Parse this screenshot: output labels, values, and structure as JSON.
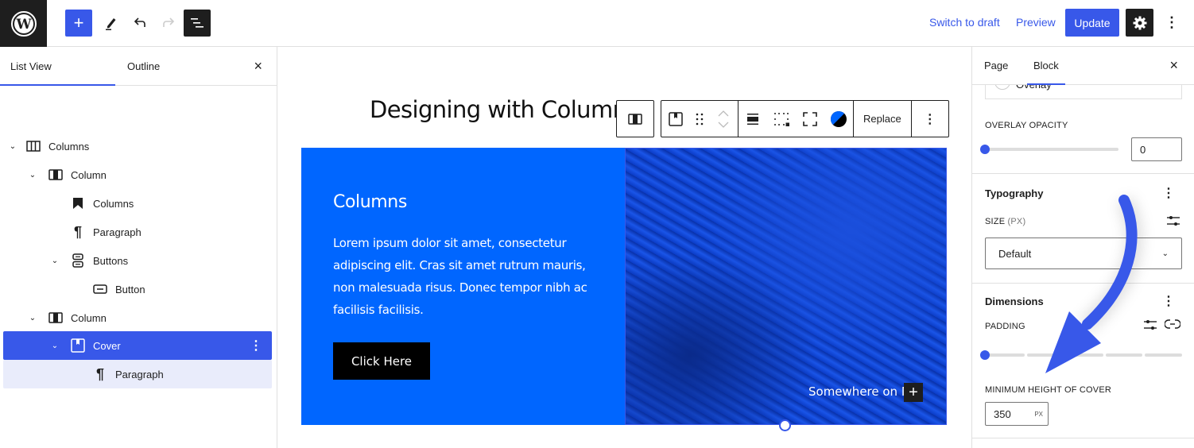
{
  "topbar": {
    "logo": "wordpress-logo",
    "add_block_label": "+",
    "switch_to_draft": "Switch to draft",
    "preview": "Preview",
    "update": "Update",
    "more": "⋮"
  },
  "left_panel": {
    "tabs": [
      {
        "label": "List View",
        "active": true
      },
      {
        "label": "Outline",
        "active": false
      }
    ],
    "close": "×",
    "tree": [
      {
        "label": "Columns",
        "icon": "columns-icon",
        "level": 0,
        "expanded": true
      },
      {
        "label": "Column",
        "icon": "column-icon",
        "level": 1,
        "expanded": true
      },
      {
        "label": "Columns",
        "icon": "bookmark-icon",
        "level": 2,
        "expanded": null
      },
      {
        "label": "Paragraph",
        "icon": "paragraph-icon",
        "level": 2,
        "expanded": null
      },
      {
        "label": "Buttons",
        "icon": "buttons-icon",
        "level": 2,
        "expanded": true
      },
      {
        "label": "Button",
        "icon": "button-icon",
        "level": 3,
        "expanded": null
      },
      {
        "label": "Column",
        "icon": "column-icon",
        "level": 1,
        "expanded": true
      },
      {
        "label": "Cover",
        "icon": "cover-icon",
        "level": 2,
        "expanded": true,
        "selected": true
      },
      {
        "label": "Paragraph",
        "icon": "paragraph-icon",
        "level": 3,
        "expanded": null,
        "child_selected": true
      }
    ]
  },
  "canvas": {
    "page_title": "Designing with Columns",
    "left_column": {
      "heading": "Columns",
      "paragraph": "Lorem ipsum dolor sit amet, consectetur adipiscing elit. Cras sit amet rutrum mauris, non malesuada risus. Donec tempor nibh ac facilisis facilisis.",
      "button": "Click Here",
      "background": "#0066ff"
    },
    "cover": {
      "text": "Somewhere on M",
      "add_label": "+"
    },
    "toolbar": {
      "replace": "Replace",
      "more": "⋮"
    }
  },
  "right_panel": {
    "tabs": [
      {
        "label": "Page",
        "active": false
      },
      {
        "label": "Block",
        "active": true
      }
    ],
    "close": "×",
    "overlay_label": "Overlay",
    "overlay_opacity": {
      "label": "Overlay Opacity",
      "value": "0",
      "slider_fraction": 0
    },
    "typography": {
      "title": "Typography",
      "size_label": "Size",
      "size_unit": "(PX)",
      "size_value": "Default"
    },
    "dimensions": {
      "title": "Dimensions",
      "padding_label": "Padding",
      "padding_fraction": 0,
      "min_height_label": "Minimum height of cover",
      "min_height_value": "350",
      "min_height_unit": "PX"
    }
  },
  "colors": {
    "accent": "#3858e9",
    "dark": "#1e1e1e",
    "column_blue": "#0066ff"
  }
}
